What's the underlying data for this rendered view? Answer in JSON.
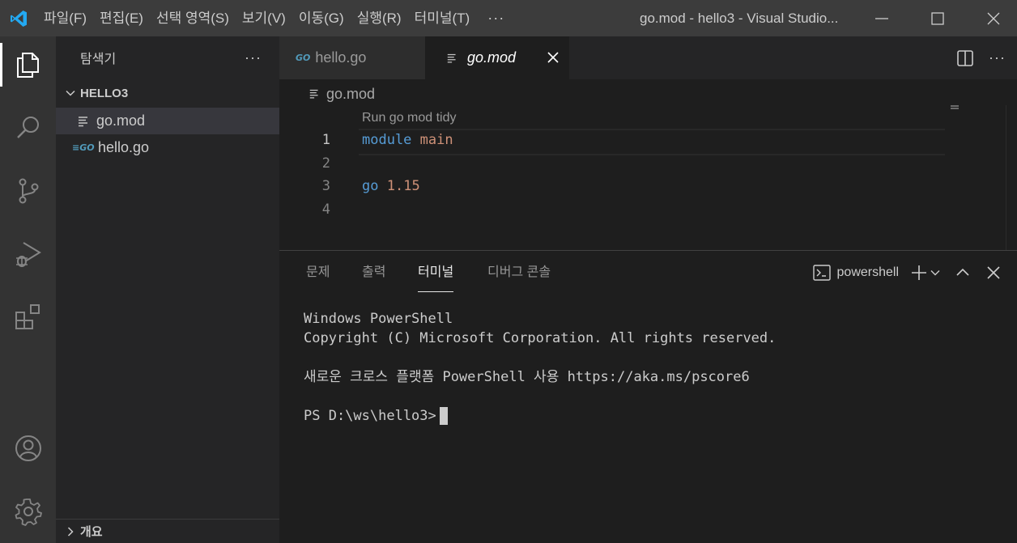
{
  "titlebar": {
    "menu": [
      "파일(F)",
      "편집(E)",
      "선택 영역(S)",
      "보기(V)",
      "이동(G)",
      "실행(R)",
      "터미널(T)"
    ],
    "more": "···",
    "window_title": "go.mod - hello3 - Visual Studio..."
  },
  "sidebar": {
    "title": "탐색기",
    "more": "···",
    "section": "HELLO3",
    "files": [
      {
        "name": "go.mod",
        "icon": "lines-icon"
      },
      {
        "name": "hello.go",
        "icon": "go-icon"
      }
    ],
    "outline": "개요"
  },
  "tabs": [
    {
      "label": "hello.go",
      "icon_text": "GO"
    },
    {
      "label": "go.mod"
    }
  ],
  "breadcrumb": "go.mod",
  "editor": {
    "codelens": "Run go mod tidy",
    "lines": [
      {
        "num": "1",
        "kw": "module",
        "val": "main"
      },
      {
        "num": "2",
        "kw": "",
        "val": ""
      },
      {
        "num": "3",
        "kw": "go",
        "val": "1.15"
      },
      {
        "num": "4",
        "kw": "",
        "val": ""
      }
    ]
  },
  "panel": {
    "tabs": [
      "문제",
      "출력",
      "터미널",
      "디버그 콘솔"
    ],
    "active_tab": "터미널",
    "shell": "powershell",
    "terminal_lines": [
      "Windows PowerShell",
      "Copyright (C) Microsoft Corporation. All rights reserved.",
      "",
      "새로운 크로스 플랫폼 PowerShell 사용 https://aka.ms/pscore6",
      "",
      "PS D:\\ws\\hello3>"
    ]
  },
  "colors": {
    "accent": "#007acc",
    "keyword": "#569cd6",
    "string": "#ce9178",
    "go_blue": "#519aba"
  }
}
